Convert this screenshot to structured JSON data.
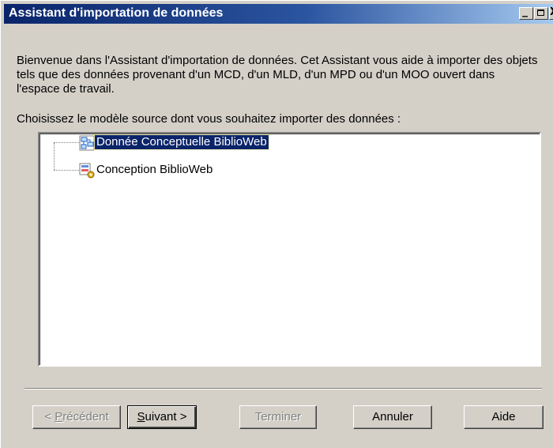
{
  "window": {
    "title": "Assistant d'importation de données",
    "minimize_glyph": "_",
    "close_glyph": "X"
  },
  "intro_text": "Bienvenue dans l'Assistant d'importation de données. Cet Assistant vous aide à importer des objets tels que des données provenant d'un MCD, d'un MLD, d'un MPD ou d'un MOO ouvert dans l'espace de travail.",
  "prompt_text": "Choisissez le modèle source dont vous souhaitez importer des données :",
  "tree": {
    "items": [
      {
        "label": "Donnée Conceptuelle BiblioWeb",
        "icon": "conceptual-model-icon",
        "selected": true
      },
      {
        "label": "Conception BiblioWeb",
        "icon": "physical-model-icon",
        "selected": false
      }
    ]
  },
  "buttons": {
    "previous": {
      "pre": "< ",
      "mnemonic": "P",
      "post": "récédent",
      "enabled": false
    },
    "next": {
      "mnemonic": "S",
      "post": "uivant >",
      "enabled": true
    },
    "finish": {
      "label": "Terminer",
      "enabled": false
    },
    "cancel": {
      "label": "Annuler",
      "enabled": true
    },
    "help": {
      "label": "Aide",
      "enabled": true
    }
  },
  "colors": {
    "title_gradient_start": "#0a246a",
    "title_gradient_end": "#a6caf0",
    "selection": "#0a246a",
    "face": "#d4d0c8"
  }
}
